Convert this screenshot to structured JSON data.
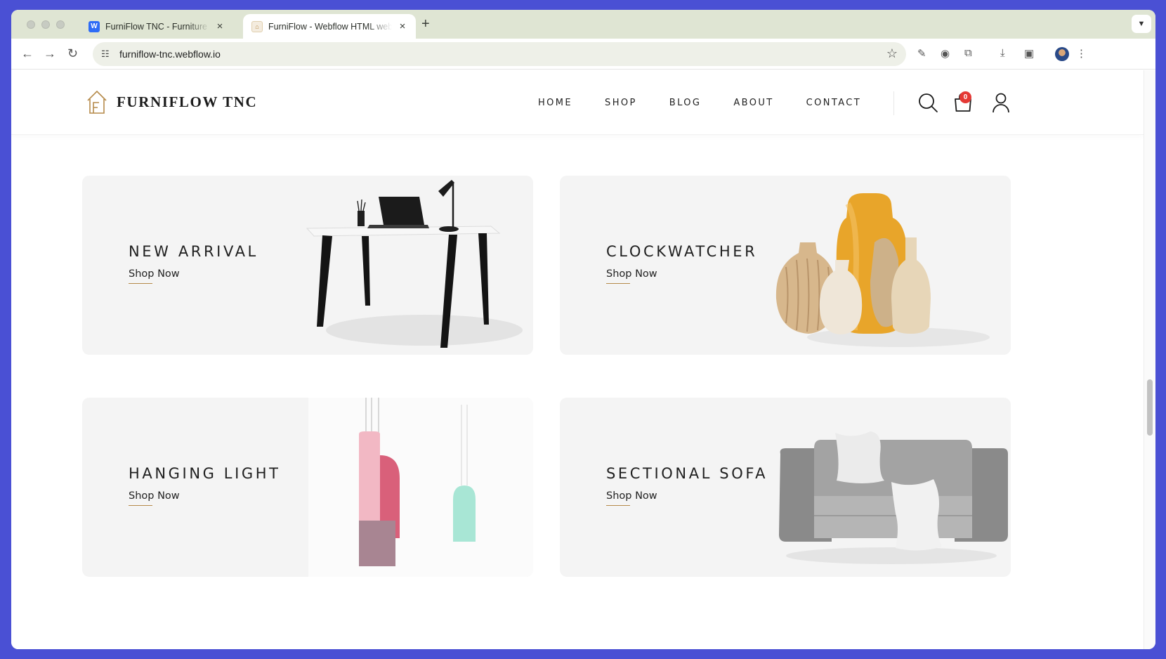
{
  "browser": {
    "tabs": [
      {
        "title": "FurniFlow TNC - Furniture HTML",
        "active": false
      },
      {
        "title": "FurniFlow - Webflow HTML website",
        "active": true
      }
    ],
    "address": "furniflow-tnc.webflow.io"
  },
  "site": {
    "brand": "FURNIFLOW TNC",
    "nav": [
      "HOME",
      "SHOP",
      "BLOG",
      "ABOUT",
      "CONTACT"
    ],
    "cart_count": "0",
    "accent_color": "#b58a4a"
  },
  "banners": [
    {
      "title": "NEW ARRIVAL",
      "link": "Shop Now",
      "image": "desk-with-laptop-and-lamp"
    },
    {
      "title": "CLOCKWATCHER",
      "link": "Shop Now",
      "image": "ceramic-vases"
    },
    {
      "title": "HANGING LIGHT",
      "link": "Shop Now",
      "image": "pendant-lights"
    },
    {
      "title": "SECTIONAL SOFA",
      "link": "Shop Now",
      "image": "grey-armchair-with-pillows"
    }
  ]
}
